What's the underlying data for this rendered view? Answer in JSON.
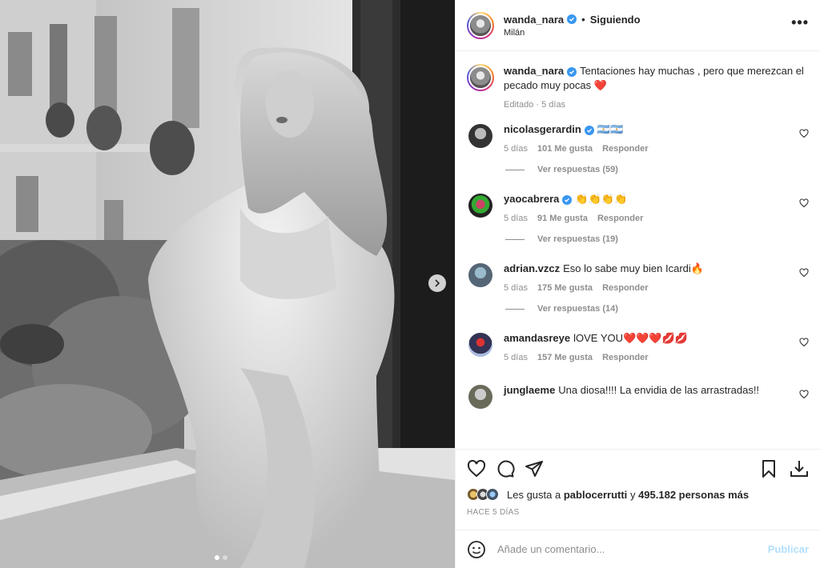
{
  "post": {
    "author": "wanda_nara",
    "following_label": "Siguiendo",
    "location": "Milán",
    "more_label": "•••"
  },
  "caption": {
    "username": "wanda_nara",
    "text": "Tentaciones hay muchas , pero que merezcan el pecado muy pocas ❤️",
    "edited": "Editado",
    "age": "5 días"
  },
  "comments": [
    {
      "username": "nicolasgerardin",
      "verified": true,
      "text": "🇦🇷🇦🇷",
      "age": "5 días",
      "likes": "101 Me gusta",
      "reply_label": "Responder",
      "replies": "Ver respuestas (59)"
    },
    {
      "username": "yaocabrera",
      "verified": true,
      "text": "👏👏👏👏",
      "age": "5 días",
      "likes": "91 Me gusta",
      "reply_label": "Responder",
      "replies": "Ver respuestas (19)"
    },
    {
      "username": "adrian.vzcz",
      "verified": false,
      "text": "Eso lo sabe muy bien Icardi🔥",
      "age": "5 días",
      "likes": "175 Me gusta",
      "reply_label": "Responder",
      "replies": "Ver respuestas (14)"
    },
    {
      "username": "amandasreye",
      "verified": false,
      "text": "lOVE YOU❤️❤️❤️💋💋",
      "age": "5 días",
      "likes": "157 Me gusta",
      "reply_label": "Responder",
      "replies": ""
    },
    {
      "username": "junglaeme",
      "verified": false,
      "text": "Una diosa!!!! La envidia de las arrastradas!!",
      "age": "",
      "likes": "",
      "reply_label": "",
      "replies": ""
    }
  ],
  "likes": {
    "prefix": "Les gusta a",
    "user": "pablocerrutti",
    "conj": "y",
    "others": "495.182 personas más"
  },
  "time": "HACE 5 DÍAS",
  "comment_box": {
    "placeholder": "Añade un comentario...",
    "publish_label": "Publicar"
  },
  "carousel": {
    "slides": 2,
    "active": 1
  },
  "colors": {
    "verified": "#3897f0",
    "link_disabled": "#b2dffc",
    "meta": "#8e8e8e",
    "text": "#262626"
  },
  "icons": [
    "chevron-right-icon",
    "heart-icon",
    "comment-icon",
    "share-icon",
    "bookmark-icon",
    "download-icon",
    "emoji-icon",
    "verified-icon"
  ]
}
